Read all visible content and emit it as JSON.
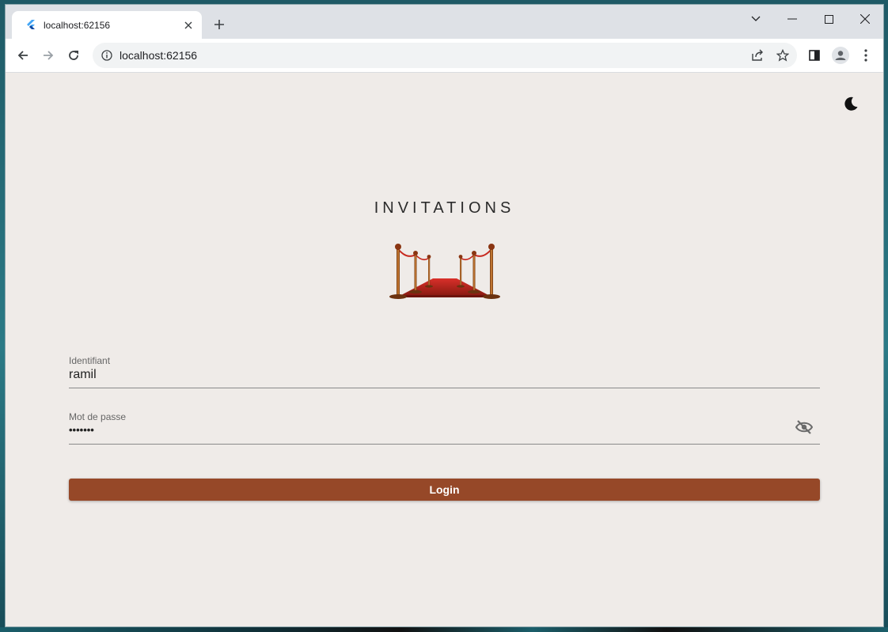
{
  "browser": {
    "tab_title": "localhost:62156",
    "url": "localhost:62156",
    "icons": {
      "favicon": "flutter-icon",
      "close": "close-icon",
      "new_tab": "plus-icon",
      "back": "arrow-left-icon",
      "forward": "arrow-right-icon",
      "reload": "reload-icon",
      "info": "info-icon",
      "share": "share-icon",
      "bookmark": "star-icon",
      "side_panel": "side-panel-icon",
      "profile": "profile-icon",
      "menu": "kebab-menu-icon"
    }
  },
  "app": {
    "title": "INVITATIONS",
    "theme_toggle_icon": "moon-icon",
    "logo": "red-carpet-illustration",
    "username": {
      "label": "Identifiant",
      "value": "ramil"
    },
    "password": {
      "label": "Mot de passe",
      "value": "•••••••",
      "toggle_icon": "eye-off-icon"
    },
    "login_label": "Login",
    "colors": {
      "accent": "#964828",
      "background": "#efebe8",
      "carpet": "#c0281c",
      "post": "#a0521f"
    }
  }
}
